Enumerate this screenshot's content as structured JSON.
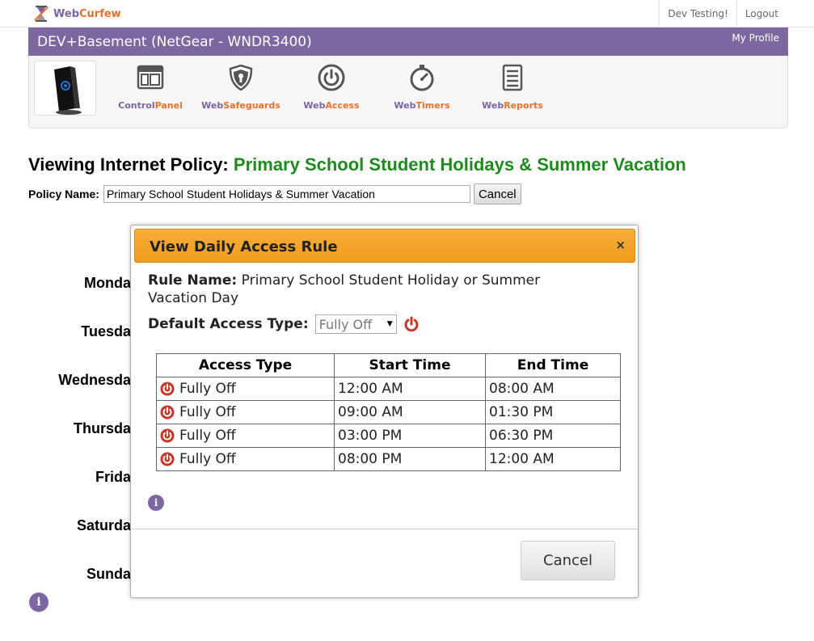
{
  "app": {
    "logo_web": "Web",
    "logo_curfew": "Curfew"
  },
  "toplinks": {
    "user": "Dev Testing!",
    "logout": "Logout"
  },
  "device": {
    "title": "DEV+Basement (NetGear - WNDR3400)",
    "my_profile": "My Profile"
  },
  "nav": [
    {
      "part1": "Control",
      "part2": "Panel",
      "icon": "control-panel-icon"
    },
    {
      "part1": "Web",
      "part2": "Safeguards",
      "icon": "shield-keyhole-icon"
    },
    {
      "part1": "Web",
      "part2": "Access",
      "icon": "power-icon"
    },
    {
      "part1": "Web",
      "part2": "Timers",
      "icon": "stopwatch-icon"
    },
    {
      "part1": "Web",
      "part2": "Reports",
      "icon": "report-document-icon"
    }
  ],
  "heading": {
    "prefix": "Viewing Internet Policy:",
    "policy": "Primary School Student Holidays & Summer Vacation"
  },
  "policy_form": {
    "label": "Policy Name:",
    "value": "Primary School Student Holidays & Summer Vacation",
    "cancel": "Cancel"
  },
  "days": [
    "Monda",
    "Tuesda",
    "Wednesda",
    "Thursda",
    "Frida",
    "Saturda",
    "Sunda"
  ],
  "info_glyph": "i",
  "modal": {
    "title": "View Daily Access Rule",
    "close": "×",
    "rule_name_label": "Rule Name:",
    "rule_name": "Primary School Student Holiday or Summer Vacation Day",
    "default_access_label": "Default Access Type:",
    "default_access_value": "Fully Off",
    "table": {
      "headers": [
        "Access Type",
        "Start Time",
        "End Time"
      ],
      "rows": [
        {
          "access": "Fully Off",
          "start": "12:00 AM",
          "end": "08:00 AM"
        },
        {
          "access": "Fully Off",
          "start": "09:00 AM",
          "end": "01:30 PM"
        },
        {
          "access": "Fully Off",
          "start": "03:00 PM",
          "end": "06:30 PM"
        },
        {
          "access": "Fully Off",
          "start": "08:00 PM",
          "end": "12:00 AM"
        }
      ]
    },
    "cancel": "Cancel"
  },
  "colors": {
    "purple": "#7d67a0",
    "orange": "#e8702a",
    "green": "#1e8a1e",
    "power_red": "#c0392b",
    "modal_header": "#f5a623"
  }
}
